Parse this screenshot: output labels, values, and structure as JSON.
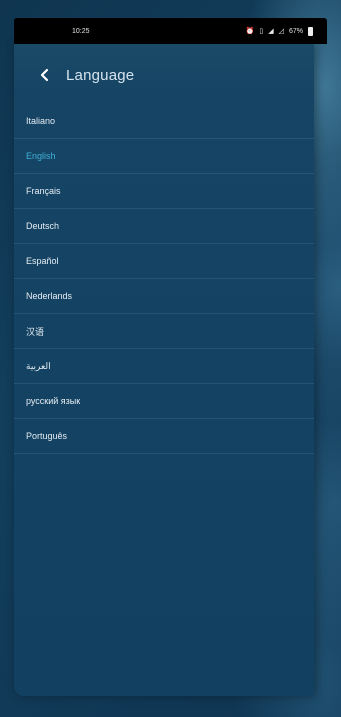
{
  "status_bar": {
    "time": "10:25",
    "battery_text": "67%",
    "icons": [
      "alarm-icon",
      "vibrate-icon",
      "signal-icon",
      "wifi-icon",
      "battery-icon"
    ]
  },
  "header": {
    "title": "Language",
    "back_icon": "chevron-left-icon"
  },
  "languages": [
    {
      "label": "Italiano",
      "selected": false
    },
    {
      "label": "English",
      "selected": true
    },
    {
      "label": "Français",
      "selected": false
    },
    {
      "label": "Deutsch",
      "selected": false
    },
    {
      "label": "Español",
      "selected": false
    },
    {
      "label": "Nederlands",
      "selected": false
    },
    {
      "label": "汉语",
      "selected": false
    },
    {
      "label": "العربية",
      "selected": false
    },
    {
      "label": "русский язык",
      "selected": false
    },
    {
      "label": "Português",
      "selected": false
    }
  ],
  "colors": {
    "selected": "#3fb0d8",
    "text": "#e6eef4",
    "drawer": "#164464"
  }
}
